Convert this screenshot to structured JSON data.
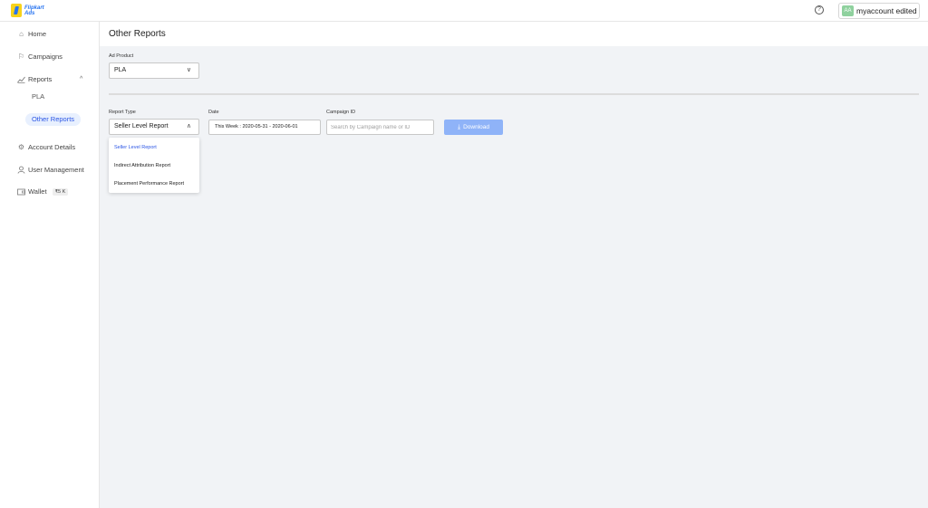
{
  "header": {
    "logo_line1": "Flipkart",
    "logo_line2": "Ads",
    "help_icon": "?",
    "avatar_initials": "AA",
    "account_name": "myaccount edited"
  },
  "sidebar": {
    "home": "Home",
    "campaigns": "Campaigns",
    "reports": "Reports",
    "reports_sub": [
      "PLA",
      "Other Reports"
    ],
    "account_details": "Account Details",
    "user_management": "User Management",
    "wallet": "Wallet",
    "wallet_balance": "₹5 K"
  },
  "page": {
    "title": "Other Reports"
  },
  "form": {
    "ad_product_label": "Ad Product",
    "ad_product_value": "PLA",
    "report_type_label": "Report Type",
    "report_type_value": "Seller Level Report",
    "date_label": "Date",
    "date_value": "This Week : 2020-05-31 - 2020-06-01",
    "campaign_label": "Campaign ID",
    "campaign_placeholder": "Search by Campaign name or ID",
    "download_label": "Download",
    "report_options": [
      "Seller Level Report",
      "Indirect Attribution Report",
      "Placement Performance Report"
    ]
  },
  "colors": {
    "accent": "#2a55e5",
    "download_bg": "#8fb3f8",
    "active_nav_bg": "#e8f0fe"
  },
  "icons": {
    "home": "home-icon",
    "campaigns": "flag-icon",
    "reports": "chart-icon",
    "account_details": "gear-icon",
    "user_management": "user-icon",
    "wallet": "wallet-icon",
    "download": "download-icon"
  }
}
